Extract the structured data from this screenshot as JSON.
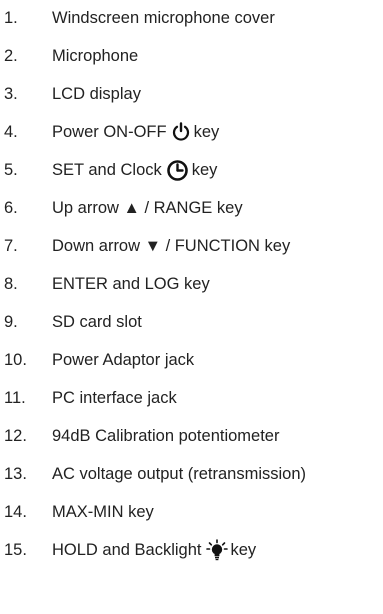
{
  "items": [
    {
      "number": "1.",
      "text": "Windscreen microphone cover"
    },
    {
      "number": "2.",
      "text": "Microphone"
    },
    {
      "number": "3.",
      "text": "LCD display"
    },
    {
      "number": "4.",
      "text_before": "Power ON-OFF",
      "icon": "power-icon",
      "text_after": "key"
    },
    {
      "number": "5.",
      "text_before": "SET and Clock",
      "icon": "clock-icon",
      "text_after": "key"
    },
    {
      "number": "6.",
      "text_before": "Up arrow",
      "glyph": "▲",
      "text_after": "/ RANGE key"
    },
    {
      "number": "7.",
      "text_before": "Down arrow",
      "glyph": "▼",
      "text_after": "/ FUNCTION key"
    },
    {
      "number": "8.",
      "text": "ENTER and LOG key"
    },
    {
      "number": "9.",
      "text": "SD card slot"
    },
    {
      "number": "10.",
      "text": "Power Adaptor jack"
    },
    {
      "number": "11.",
      "text": "PC interface jack"
    },
    {
      "number": "12.",
      "text": "94dB Calibration potentiometer"
    },
    {
      "number": "13.",
      "text": "AC voltage output (retransmission)"
    },
    {
      "number": "14.",
      "text": "MAX-MIN key"
    },
    {
      "number": "15.",
      "text_before": "HOLD and Backlight",
      "icon": "backlight-bulb-icon",
      "text_after": "key"
    }
  ]
}
